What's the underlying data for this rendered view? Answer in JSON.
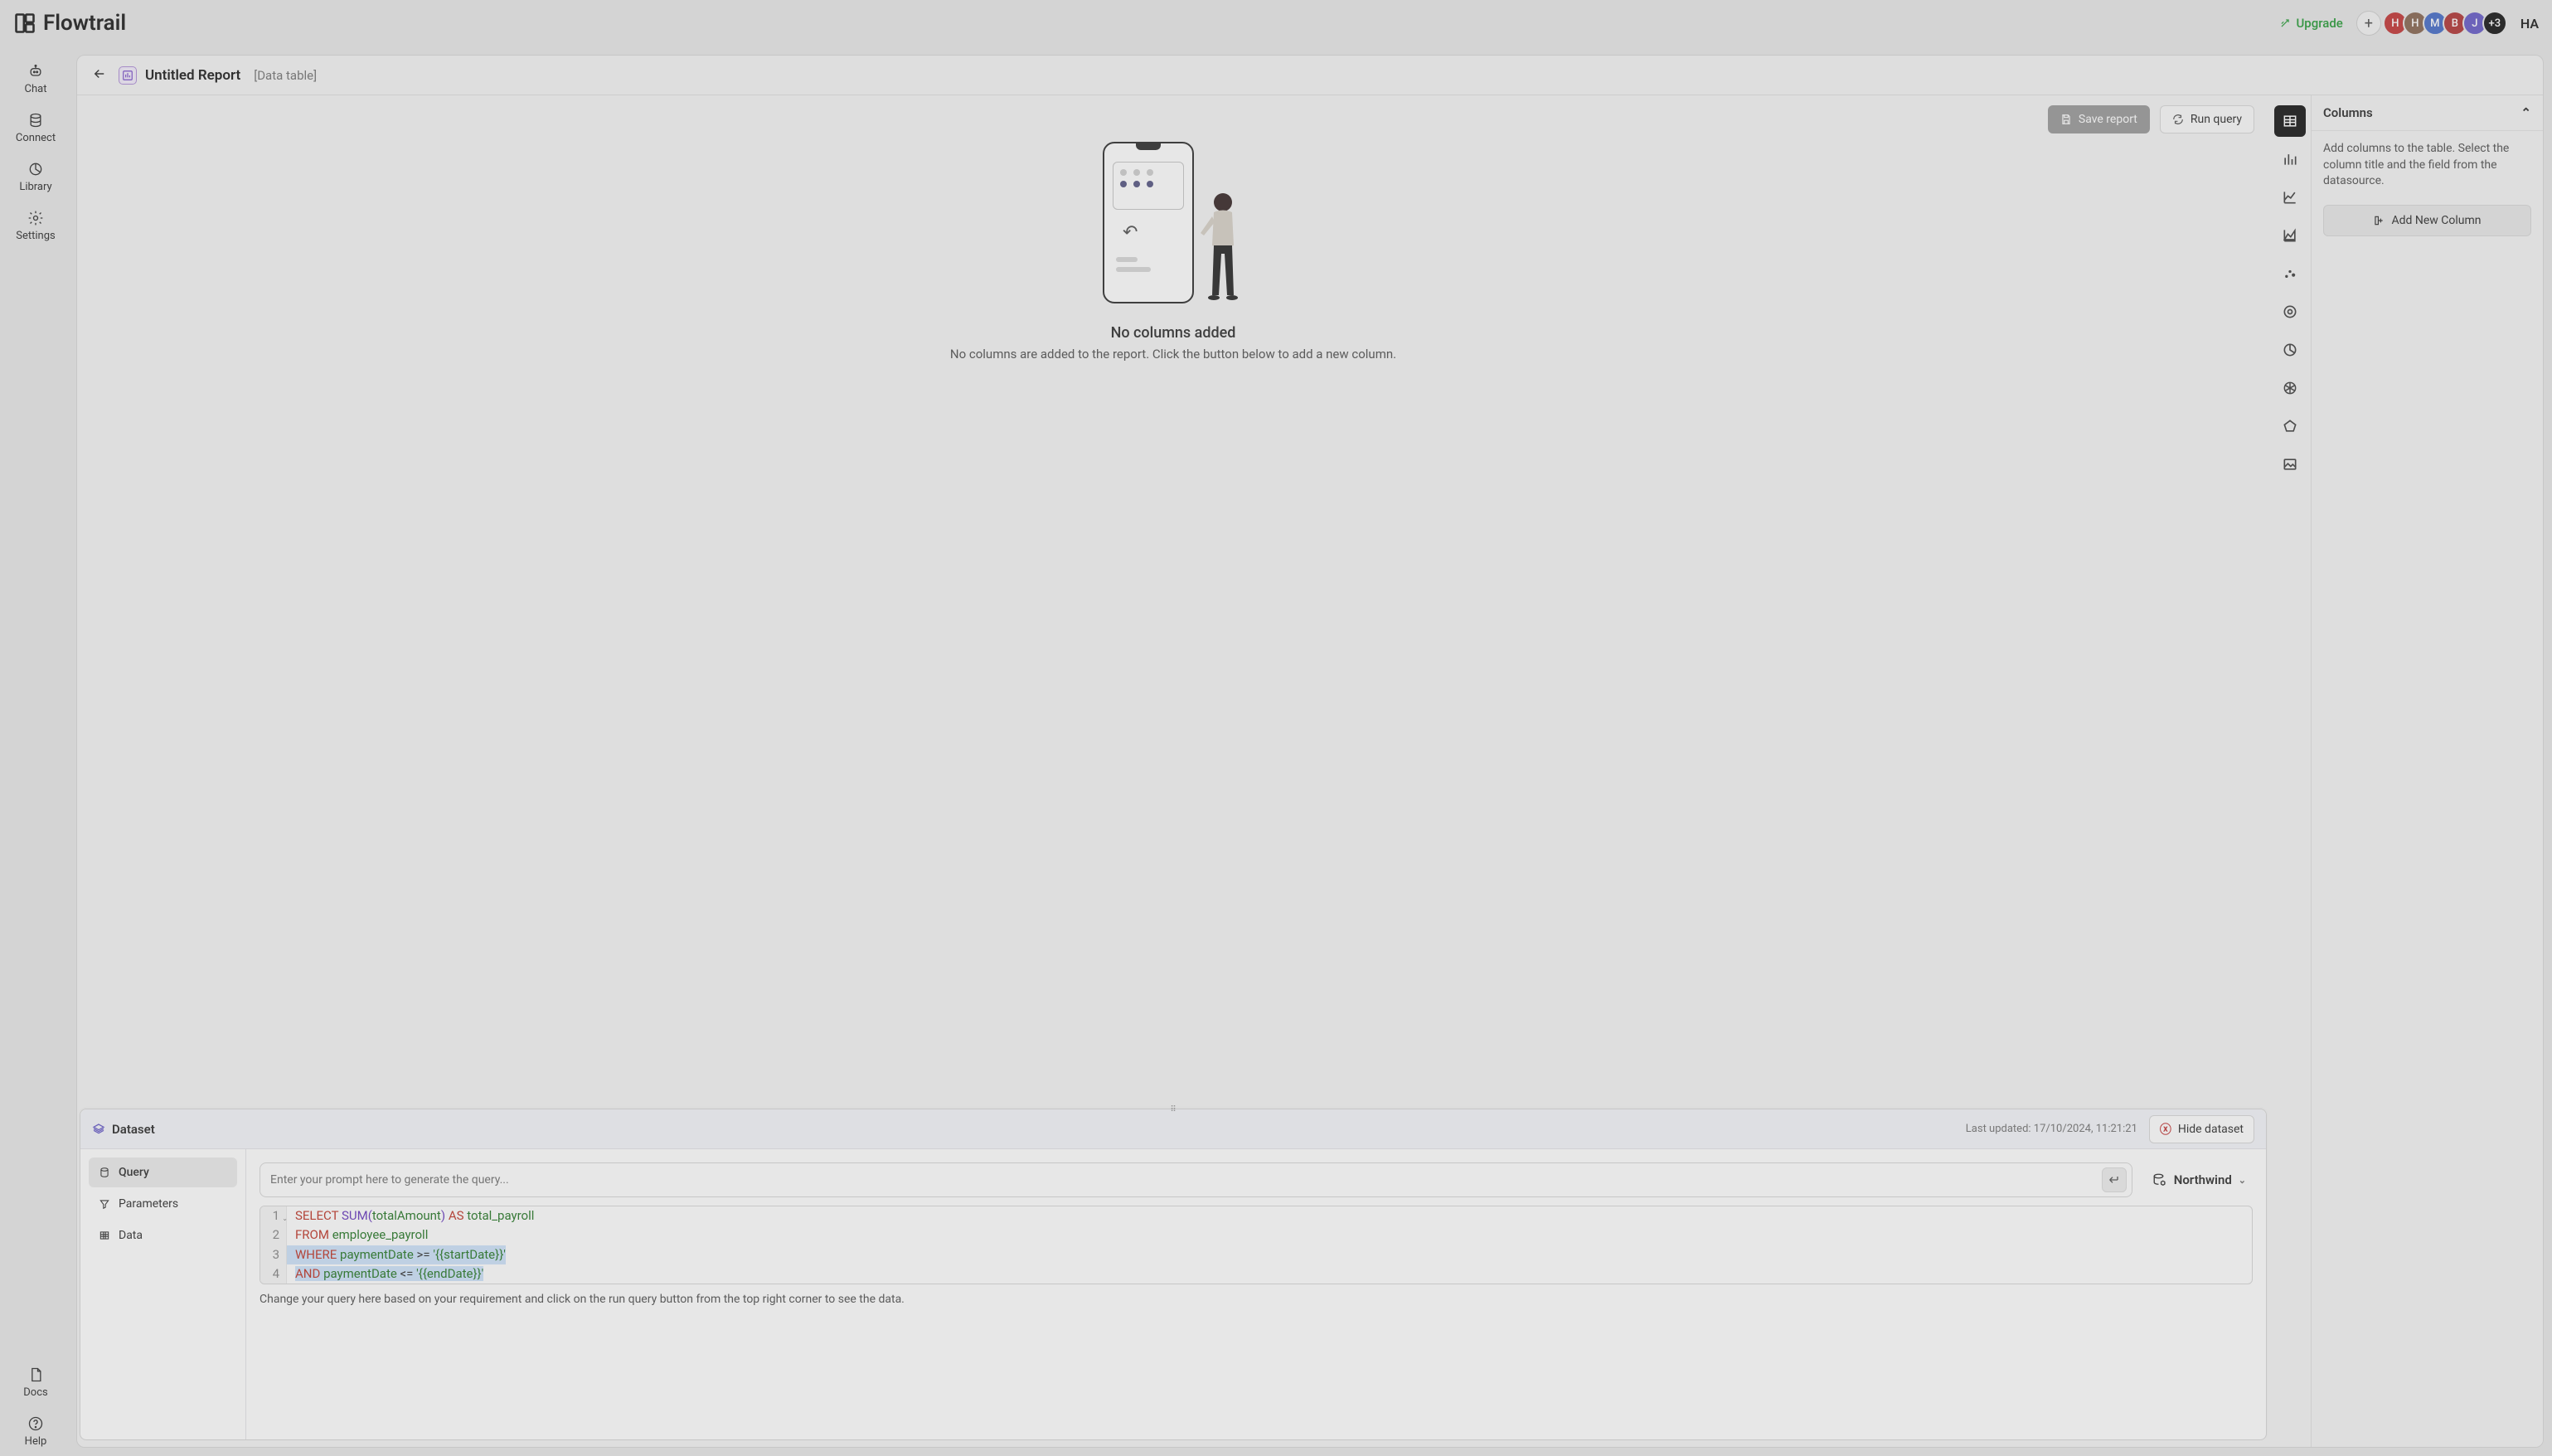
{
  "brand": "Flowtrail",
  "topbar": {
    "upgrade": "Upgrade",
    "avatars": [
      "H",
      "H",
      "M",
      "B",
      "J"
    ],
    "avatar_overflow": "+3",
    "user_initials": "HA"
  },
  "leftrail": {
    "chat": "Chat",
    "connect": "Connect",
    "library": "Library",
    "settings": "Settings",
    "docs": "Docs",
    "help": "Help"
  },
  "header": {
    "title": "Untitled Report",
    "subtitle": "[Data table]"
  },
  "toolbar": {
    "save": "Save report",
    "run": "Run query"
  },
  "empty": {
    "title": "No columns added",
    "subtitle": "No columns are added to the report. Click the button below to add a new column."
  },
  "dataset": {
    "title": "Dataset",
    "last_updated_label": "Last updated: 17/10/2024, 11:21:21",
    "hide": "Hide dataset",
    "tabs": {
      "query": "Query",
      "parameters": "Parameters",
      "data": "Data"
    },
    "prompt_placeholder": "Enter your prompt here to generate the query...",
    "datasource": "Northwind",
    "code_lines": [
      "1",
      "2",
      "3",
      "4"
    ],
    "sql": {
      "l1_select": "SELECT",
      "l1_sum": "SUM",
      "l1_col": "totalAmount",
      "l1_as": "AS",
      "l1_alias": "total_payroll",
      "l2_from": "FROM",
      "l2_tbl": "employee_payroll",
      "l3_where": "WHERE",
      "l3_col": "paymentDate",
      "l3_op": ">=",
      "l3_val": "'{{startDate}}'",
      "l4_and": "AND",
      "l4_col": "paymentDate",
      "l4_op": "<=",
      "l4_val": "'{{endDate}}'"
    },
    "help": "Change your query here based on your requirement and click on the run query button from the top right corner to see the data."
  },
  "columns": {
    "title": "Columns",
    "desc": "Add columns to the table. Select the column title and the field from the datasource.",
    "add": "Add New Column"
  }
}
